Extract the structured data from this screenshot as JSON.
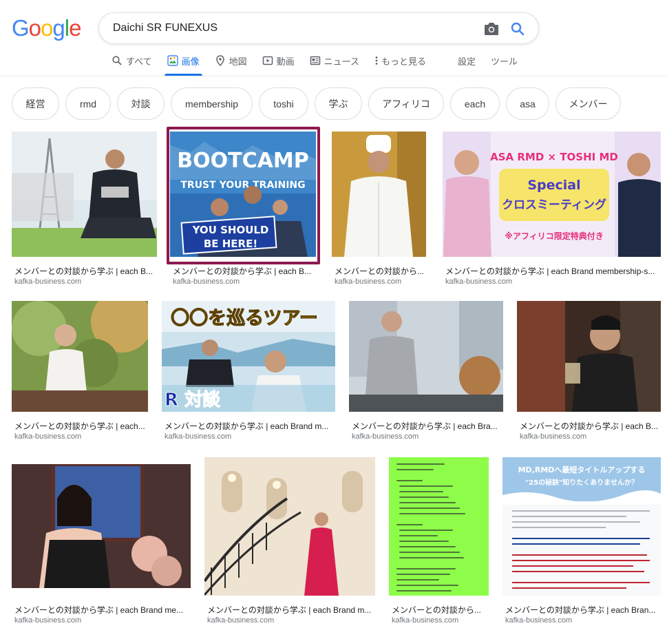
{
  "logo": {
    "text": "Google",
    "letters": [
      "G",
      "o",
      "o",
      "g",
      "l",
      "e"
    ],
    "colors": [
      "#4285f4",
      "#ea4335",
      "#fbbc05",
      "#4285f4",
      "#34a853",
      "#ea4335"
    ]
  },
  "search": {
    "query": "Daichi SR FUNEXUS",
    "camera_icon": "camera-icon",
    "search_icon": "search-icon"
  },
  "tabs": [
    {
      "label": "すべて",
      "icon": "search-icon"
    },
    {
      "label": "画像",
      "icon": "images-icon",
      "active": true
    },
    {
      "label": "地図",
      "icon": "map-pin-icon"
    },
    {
      "label": "動画",
      "icon": "video-icon"
    },
    {
      "label": "ニュース",
      "icon": "news-icon"
    },
    {
      "label": "もっと見る",
      "icon": "more-dots-icon"
    }
  ],
  "settings_label": "設定",
  "tools_label": "ツール",
  "chips": [
    "経営",
    "rmd",
    "対談",
    "membership",
    "toshi",
    "学ぶ",
    "アフィリコ",
    "each",
    "asa",
    "メンバー"
  ],
  "results": [
    {
      "caption": "メンバーとの対談から学ぶ | each B...",
      "source": "kafka-business.com",
      "overlay": []
    },
    {
      "caption": "メンバーとの対談から学ぶ | each B...",
      "source": "kafka-business.com",
      "selected": true,
      "overlay": [
        "BOOTCAMP",
        "TRUST YOUR TRAINING",
        "YOU SHOULD",
        "BE HERE!"
      ]
    },
    {
      "caption": "メンバーとの対談から...",
      "source": "kafka-business.com",
      "overlay": []
    },
    {
      "caption": "メンバーとの対談から学ぶ | each Brand membership-s...",
      "source": "kafka-business.com",
      "overlay": [
        "ASA RMD × TOSHI MD",
        "Special",
        "クロスミーティング",
        "※アフィリコ限定特典付き"
      ]
    },
    {
      "caption": "メンバーとの対談から学ぶ | each...",
      "source": "kafka-business.com",
      "overlay": []
    },
    {
      "caption": "メンバーとの対談から学ぶ | each Brand m...",
      "source": "kafka-business.com",
      "overlay": [
        "〇〇を巡るツアー",
        "R 対談"
      ]
    },
    {
      "caption": "メンバーとの対談から学ぶ | each Bra...",
      "source": "kafka-business.com",
      "overlay": []
    },
    {
      "caption": "メンバーとの対談から学ぶ | each B...",
      "source": "kafka-business.com",
      "overlay": []
    },
    {
      "caption": "メンバーとの対談から学ぶ | each Brand me...",
      "source": "kafka-business.com",
      "overlay": []
    },
    {
      "caption": "メンバーとの対談から学ぶ | each Brand m...",
      "source": "kafka-business.com",
      "overlay": []
    },
    {
      "caption": "メンバーとの対談から...",
      "source": "kafka-business.com",
      "overlay": []
    },
    {
      "caption": "メンバーとの対談から学ぶ | each Bran...",
      "source": "kafka-business.com",
      "overlay": [
        "MD,RMDへ最短タイトルアップする",
        "\"25の秘訣\"知りたくありませんか？"
      ]
    }
  ],
  "colors": {
    "accent": "#1a73e8",
    "selected_border": "#8b1a4f",
    "chip_border": "#dadce0",
    "source_text": "#70757a"
  }
}
